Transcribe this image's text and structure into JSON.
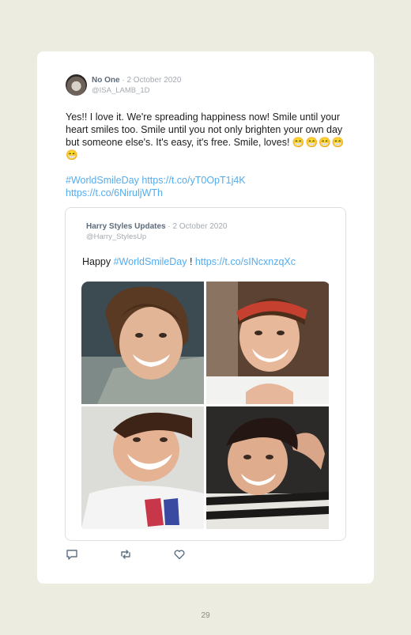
{
  "tweet": {
    "author_name": "No One",
    "separator": "·",
    "date": "2 October 2020",
    "handle": "@ISA_LAMB_1D",
    "text": "Yes!! I love it. We're spreading happiness now! Smile until your heart smiles too. Smile until you not only brighten your own day but someone else's. It's easy, it's free. Smile, loves!",
    "emojis": "😁😁😁😁😁",
    "hashtag": "#WorldSmileDay",
    "link_1": "https://t.co/yT0OpT1j4K",
    "link_2": "https://t.co/6NiruljWTh"
  },
  "quoted_tweet": {
    "author_name": "Harry Styles Updates",
    "separator": "·",
    "date": "2 October 2020",
    "handle": "@Harry_StylesUp",
    "text_prefix": "Happy ",
    "hashtag": "#WorldSmileDay",
    "text_middle": " ! ",
    "link": "https://t.co/sINcxnzqXc",
    "photos": [
      "smiling-photo-1",
      "smiling-photo-2",
      "smiling-photo-3",
      "smiling-photo-4"
    ]
  },
  "actions": [
    "reply-icon",
    "retweet-icon",
    "like-icon"
  ],
  "colors": {
    "page_background": "#ecece0",
    "card_background": "#ffffff",
    "link": "#55acee",
    "name": "#5d6b79",
    "muted": "#a4aab0"
  },
  "page_number": "29"
}
